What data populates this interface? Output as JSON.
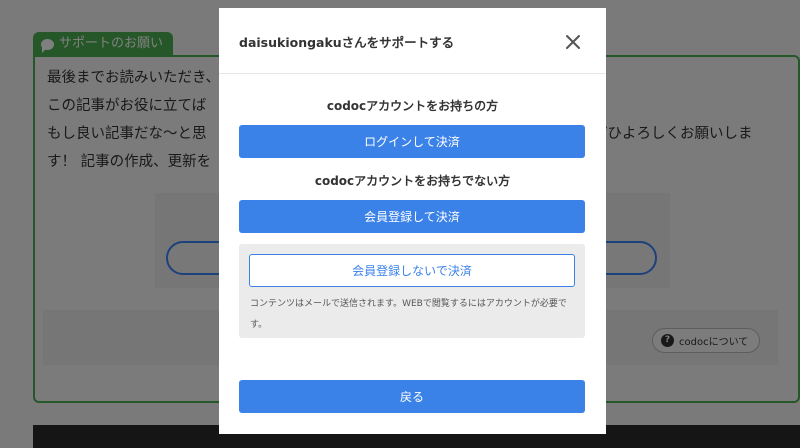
{
  "background": {
    "support_tab_label": "サポートのお願い",
    "support_lines": [
      "最後までお読みいただき、",
      "この記事がお役に立てば",
      "もし良い記事だな〜と思",
      "す！ 記事の作成、更新を"
    ],
    "support_line_right": "ぜひよろしくお願いしま",
    "about_codoc_label": "codocについて"
  },
  "modal": {
    "title": "daisukiongakuさんをサポートする",
    "has_account_label": "codocアカウントをお持ちの方",
    "login_button": "ログインして決済",
    "no_account_label": "codocアカウントをお持ちでない方",
    "register_button": "会員登録して決済",
    "guest_button": "会員登録しないで決済",
    "guest_note": "コンテンツはメールで送信されます。WEBで閲覧するにはアカウントが必要です。",
    "back_button": "戻る"
  },
  "colors": {
    "primary": "#3b82e8",
    "support_green": "#4caf50",
    "overlay": "rgba(0,0,0,0.5)"
  }
}
